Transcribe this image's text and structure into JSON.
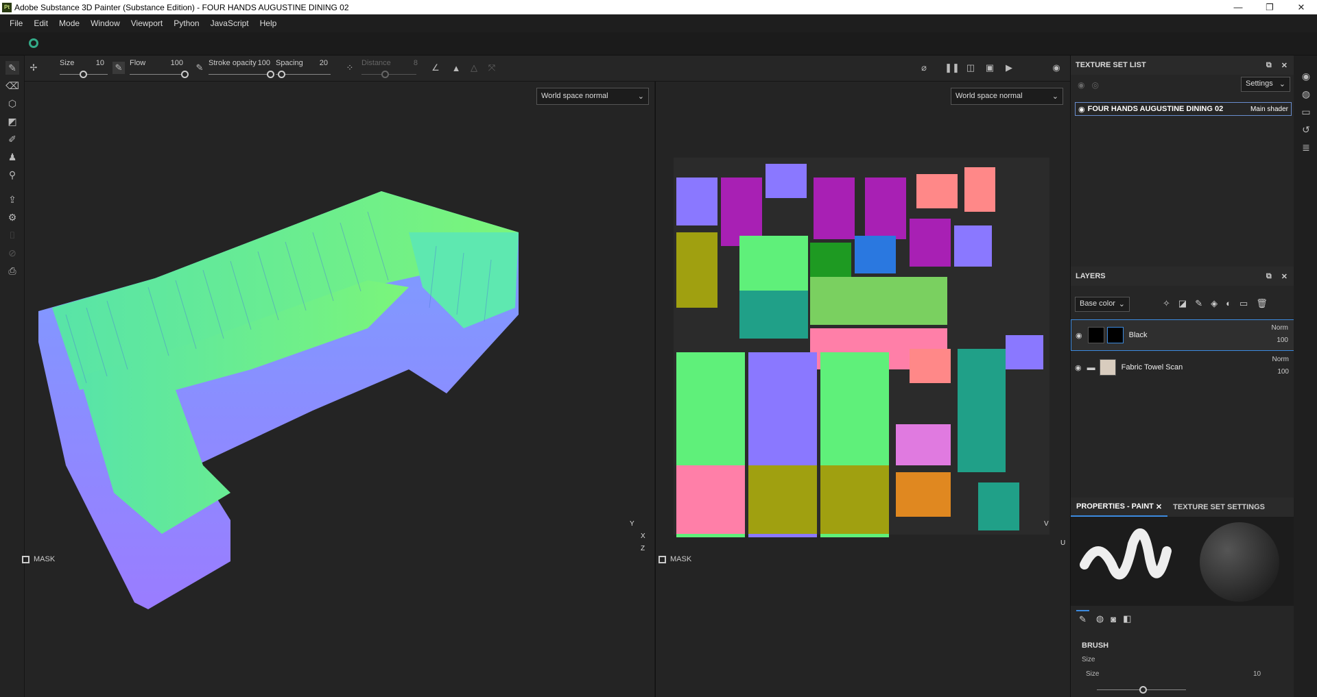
{
  "window": {
    "title": "Adobe Substance 3D Painter (Substance Edition) - FOUR HANDS AUGUSTINE DINING 02",
    "logo": "Pt"
  },
  "menu": [
    "File",
    "Edit",
    "Mode",
    "Window",
    "Viewport",
    "Python",
    "JavaScript",
    "Help"
  ],
  "toolbar": {
    "size_label": "Size",
    "size_value": "10",
    "flow_label": "Flow",
    "flow_value": "100",
    "opacity_label": "Stroke opacity",
    "opacity_value": "100",
    "spacing_label": "Spacing",
    "spacing_value": "20",
    "distance_label": "Distance",
    "distance_value": "8"
  },
  "viewport_left": {
    "mode": "World space normal",
    "mask": "MASK",
    "axes": [
      "Y",
      "X",
      "Z"
    ]
  },
  "viewport_right": {
    "mode": "World space normal",
    "mask": "MASK",
    "axes": [
      "V",
      "U"
    ]
  },
  "texture_set_list": {
    "title": "TEXTURE SET LIST",
    "settings": "Settings",
    "item_name": "FOUR HANDS AUGUSTINE DINING 02",
    "item_shader": "Main shader"
  },
  "layers": {
    "title": "LAYERS",
    "channel": "Base color",
    "items": [
      {
        "name": "Black",
        "blend": "Norm",
        "opacity": "100"
      },
      {
        "name": "Fabric Towel Scan",
        "blend": "Norm",
        "opacity": "100"
      }
    ]
  },
  "properties": {
    "tab_active": "PROPERTIES - PAINT",
    "tab_other": "TEXTURE SET SETTINGS",
    "section": "BRUSH",
    "size_header": "Size",
    "size_label": "Size",
    "size_value": "10"
  },
  "colors": {
    "accent": "#3c8be0",
    "bg": "#242424"
  }
}
